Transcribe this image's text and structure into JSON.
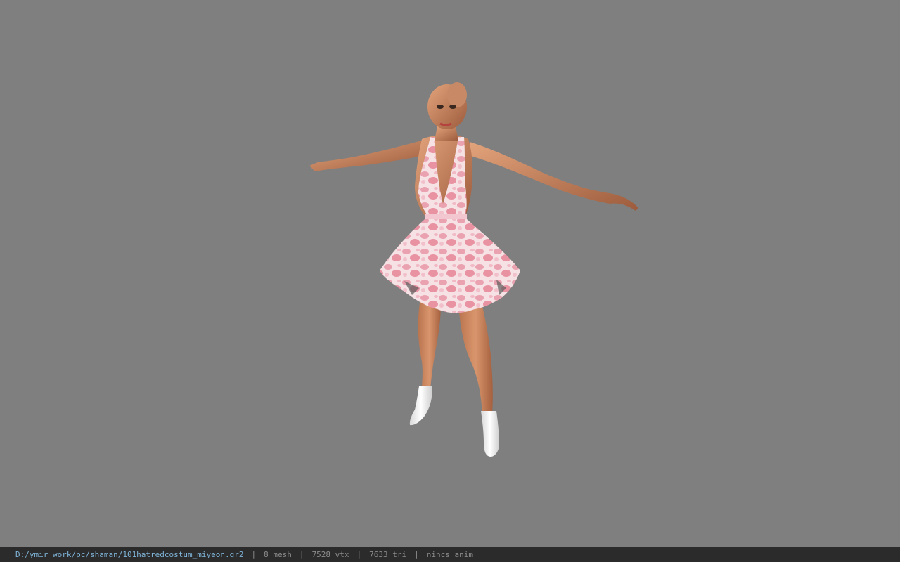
{
  "viewport": {
    "background_color": "#7f7f7f",
    "model_name": "101hatredcostum_miyeon"
  },
  "status_bar": {
    "file_path": "D:/ymir work/pc/shaman/101hatredcostum_miyeon.gr2",
    "separator": "|",
    "mesh_count": "8 mesh",
    "vertex_count": "7528 vtx",
    "triangle_count": "7633 tri",
    "anim_status": "nincs anim",
    "path_color": "#7fb4d8",
    "text_color": "#8c8c8c",
    "background_color": "#2b2b2b"
  }
}
